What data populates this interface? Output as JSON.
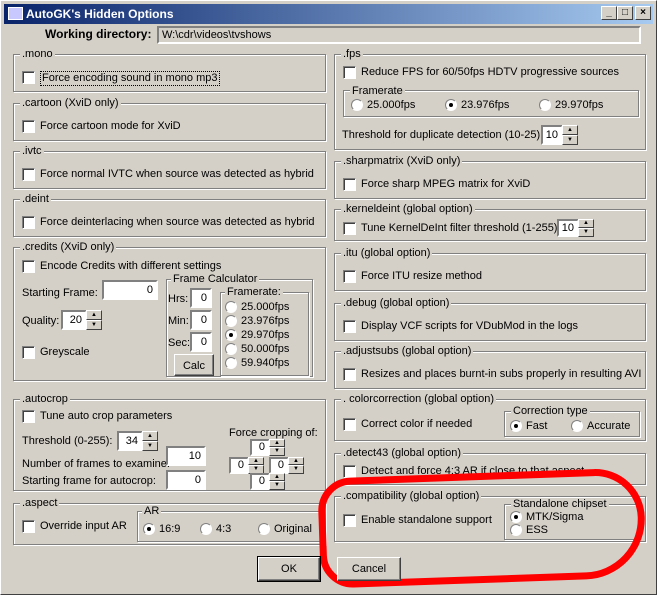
{
  "window": {
    "title": "AutoGK's Hidden Options",
    "min": "_",
    "max": "□",
    "close": "×"
  },
  "workdir": {
    "label": "Working directory:",
    "value": "W:\\cdr\\videos\\tvshows"
  },
  "mono": {
    "title": ".mono",
    "cb": "Force encoding sound in mono mp3"
  },
  "cartoon": {
    "title": ".cartoon (XviD only)",
    "cb": "Force cartoon mode for XviD"
  },
  "ivtc": {
    "title": ".ivtc",
    "cb": "Force normal IVTC when source was detected as hybrid"
  },
  "deint": {
    "title": ".deint",
    "cb": "Force deinterlacing when source was detected as hybrid"
  },
  "credits": {
    "title": ".credits (XviD only)",
    "cb": "Encode Credits with different settings",
    "start_label": "Starting Frame:",
    "start_value": "0",
    "quality_label": "Quality:",
    "quality_value": "20",
    "grey": "Greyscale",
    "calc": {
      "title": "Frame Calculator",
      "hrs": "Hrs:",
      "hrs_v": "0",
      "min": "Min:",
      "min_v": "0",
      "sec": "Sec:",
      "sec_v": "0",
      "button": "Calc",
      "fr_title": "Framerate:",
      "rates": [
        {
          "label": "25.000fps",
          "sel": false
        },
        {
          "label": "23.976fps",
          "sel": false
        },
        {
          "label": "29.970fps",
          "sel": true
        },
        {
          "label": "50.000fps",
          "sel": false
        },
        {
          "label": "59.940fps",
          "sel": false
        }
      ]
    }
  },
  "autocrop": {
    "title": ".autocrop",
    "cb": "Tune auto crop parameters",
    "thr_label": "Threshold (0-255):",
    "thr_value": "34",
    "frames_label": "Number of frames to examine:",
    "frames_value": "10",
    "startf_label": "Starting frame for autocrop:",
    "startf_value": "0",
    "force_label": "Force cropping of:",
    "top": "0",
    "left": "0",
    "right": "0",
    "bottom": "0"
  },
  "aspect": {
    "title": ".aspect",
    "cb": "Override input AR",
    "ar_title": "AR",
    "opts": [
      {
        "label": "16:9",
        "sel": true
      },
      {
        "label": "4:3",
        "sel": false
      },
      {
        "label": "Original",
        "sel": false
      }
    ]
  },
  "fps": {
    "title": ".fps",
    "cb": "Reduce FPS for 60/50fps HDTV progressive sources",
    "fr_title": "Framerate",
    "opts": [
      {
        "label": "25.000fps",
        "sel": false
      },
      {
        "label": "23.976fps",
        "sel": true
      },
      {
        "label": "29.970fps",
        "sel": false
      }
    ],
    "dup_label": "Threshold for duplicate detection (10-25):",
    "dup_value": "10"
  },
  "sharpmatrix": {
    "title": ".sharpmatrix (XviD only)",
    "cb": "Force sharp MPEG matrix for XviD"
  },
  "kerneldeint": {
    "title": ".kerneldeint (global option)",
    "cb": "Tune KernelDeInt filter threshold (1-255):",
    "value": "10"
  },
  "itu": {
    "title": ".itu (global option)",
    "cb": "Force ITU resize method"
  },
  "debug": {
    "title": ".debug (global option)",
    "cb": "Display VCF scripts for VDubMod in the logs"
  },
  "adjustsubs": {
    "title": ".adjustsubs (global option)",
    "cb": "Resizes and places burnt-in subs properly in resulting AVI"
  },
  "colorcorrection": {
    "title": ". colorcorrection (global option)",
    "cb": "Correct color if needed",
    "ct_title": "Correction type",
    "opts": [
      {
        "label": "Fast",
        "sel": true
      },
      {
        "label": "Accurate",
        "sel": false
      }
    ]
  },
  "detect43": {
    "title": ".detect43 (global option)",
    "cb": "Detect and force 4:3 AR if close to that aspect"
  },
  "compat": {
    "title": ".compatibility (global option)",
    "cb": "Enable standalone support",
    "chip_title": "Standalone chipset",
    "opts": [
      {
        "label": "MTK/Sigma",
        "sel": true
      },
      {
        "label": "ESS",
        "sel": false
      }
    ]
  },
  "buttons": {
    "ok": "OK",
    "cancel": "Cancel"
  }
}
